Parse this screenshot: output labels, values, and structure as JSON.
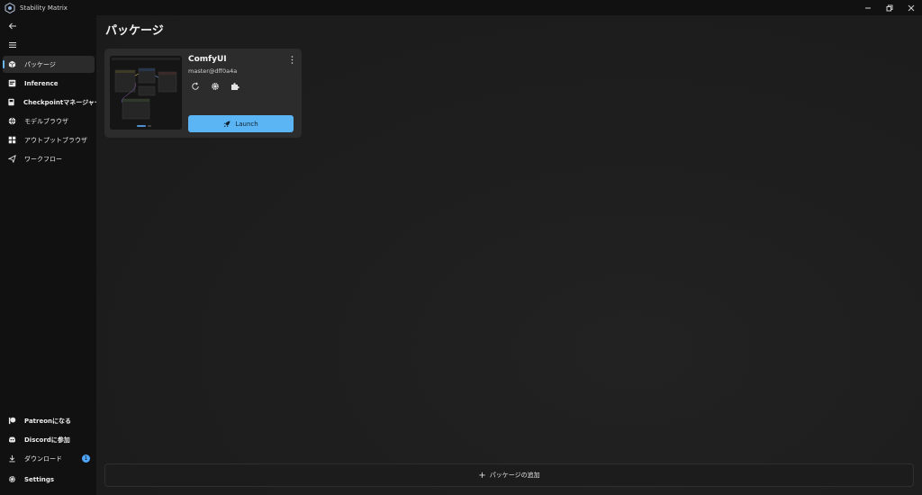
{
  "window": {
    "title": "Stability Matrix"
  },
  "sidebar": {
    "items": [
      {
        "label": "パッケージ",
        "icon": "package-icon",
        "active": true
      },
      {
        "label": "Inference",
        "icon": "inference-icon"
      },
      {
        "label": "Checkpointマネージャー",
        "icon": "checkpoint-icon"
      },
      {
        "label": "モデルブラウザ",
        "icon": "model-browser-icon"
      },
      {
        "label": "アウトプットブラウザ",
        "icon": "output-browser-icon"
      },
      {
        "label": "ワークフロー",
        "icon": "workflow-icon"
      }
    ],
    "footer": [
      {
        "label": "Patreonになる",
        "icon": "patreon-icon"
      },
      {
        "label": "Discordに参加",
        "icon": "discord-icon"
      },
      {
        "label": "ダウンロード",
        "icon": "download-icon",
        "badge": "1"
      },
      {
        "label": "Settings",
        "icon": "gear-icon"
      }
    ]
  },
  "main": {
    "title": "パッケージ",
    "package": {
      "name": "ComfyUI",
      "version": "master@dff0a4a",
      "launch_label": "Launch"
    },
    "add_package_label": "パッケージの追加"
  },
  "colors": {
    "accent": "#5bb5f5",
    "badge": "#4fa6ff",
    "sidebar_bg": "#111111",
    "card_bg": "#2c2c2c"
  }
}
